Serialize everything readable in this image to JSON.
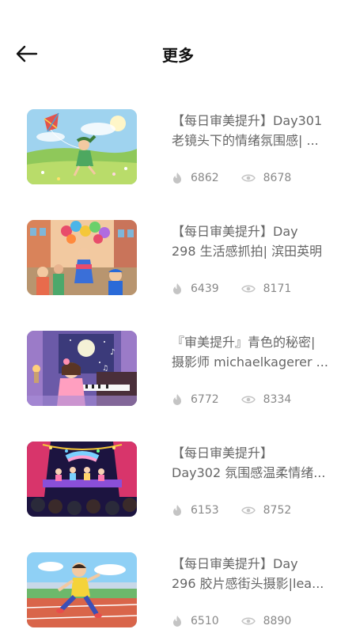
{
  "header": {
    "title": "更多"
  },
  "items": [
    {
      "title_line1": "【每日审美提升】Day301",
      "title_line2": "老镜头下的情绪氛围感| ...",
      "likes": "6862",
      "views": "8678"
    },
    {
      "title_line1": "【每日审美提升】Day",
      "title_line2": "298 生活感抓拍| 滨田英明",
      "likes": "6439",
      "views": "8171"
    },
    {
      "title_line1": "『审美提升』青色的秘密|",
      "title_line2": "摄影师 michaelkagerer ...",
      "likes": "6772",
      "views": "8334"
    },
    {
      "title_line1": "【每日审美提升】",
      "title_line2": "Day302 氛围感温柔情绪...",
      "likes": "6153",
      "views": "8752"
    },
    {
      "title_line1": "【每日审美提升】Day",
      "title_line2": "296 胶片感街头摄影|lea...",
      "likes": "6510",
      "views": "8890"
    }
  ]
}
